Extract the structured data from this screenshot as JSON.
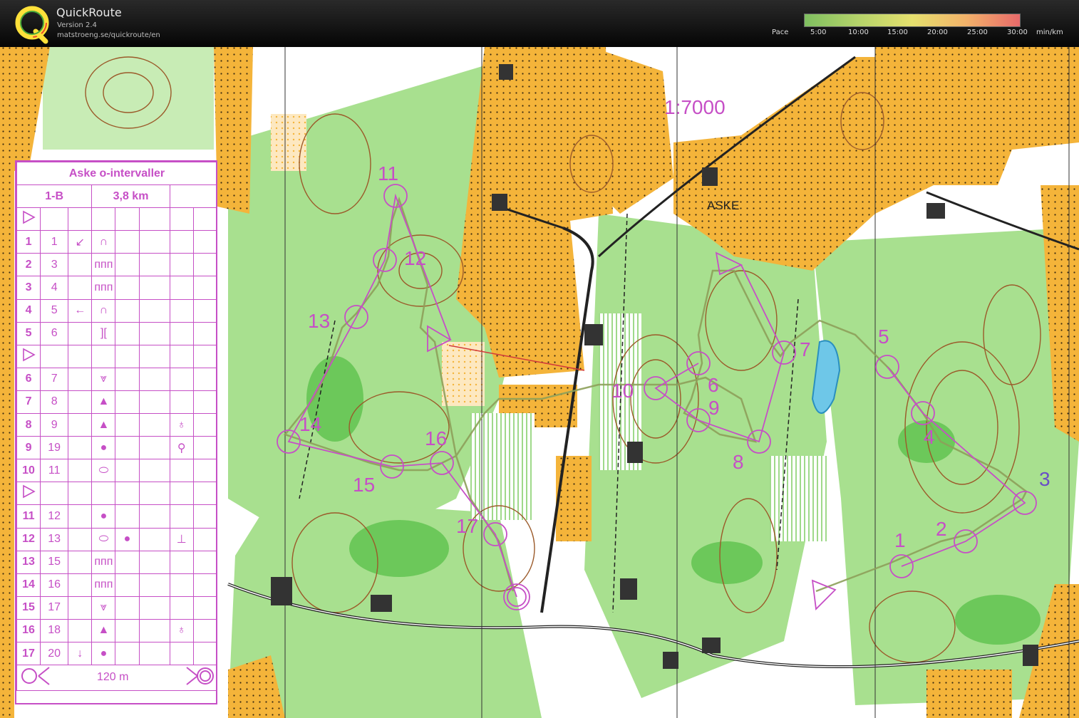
{
  "app": {
    "name": "QuickRoute",
    "version": "Version 2.4",
    "url": "matstroeng.se/quickroute/en"
  },
  "pace_legend": {
    "label": "Pace",
    "ticks": [
      "5:00",
      "10:00",
      "15:00",
      "20:00",
      "25:00",
      "30:00"
    ],
    "unit": "min/km"
  },
  "map": {
    "scale": "1:7000",
    "place_name": "ASKE",
    "control_labels": [
      "1",
      "2",
      "3",
      "4",
      "5",
      "6",
      "7",
      "8",
      "9",
      "10",
      "11",
      "12",
      "13",
      "14",
      "15",
      "16",
      "17"
    ]
  },
  "description_sheet": {
    "event": "Aske o-intervaller",
    "course": "1-B",
    "length": "3,8 km",
    "rows": [
      {
        "type": "start"
      },
      {
        "n": "1",
        "code": "1",
        "dir": "↙",
        "feat": "∩"
      },
      {
        "n": "2",
        "code": "3",
        "feat": "ᴨᴨᴨ"
      },
      {
        "n": "3",
        "code": "4",
        "feat": "ᴨᴨᴨ"
      },
      {
        "n": "4",
        "code": "5",
        "dir": "←",
        "feat": "∩"
      },
      {
        "n": "5",
        "code": "6",
        "feat": "][ "
      },
      {
        "type": "start"
      },
      {
        "n": "6",
        "code": "7",
        "feat": "⩔"
      },
      {
        "n": "7",
        "code": "8",
        "feat": "▲"
      },
      {
        "n": "8",
        "code": "9",
        "feat": "▲",
        "extra": "♁"
      },
      {
        "n": "9",
        "code": "19",
        "feat": "●",
        "extra": "⚲"
      },
      {
        "n": "10",
        "code": "11",
        "feat": "⬭"
      },
      {
        "type": "start"
      },
      {
        "n": "11",
        "code": "12",
        "feat": "●"
      },
      {
        "n": "12",
        "code": "13",
        "feat": "⬭",
        "mid": "●",
        "extra": "⊥"
      },
      {
        "n": "13",
        "code": "15",
        "feat": "ᴨᴨᴨ"
      },
      {
        "n": "14",
        "code": "16",
        "feat": "ᴨᴨᴨ"
      },
      {
        "n": "15",
        "code": "17",
        "feat": "⩔"
      },
      {
        "n": "16",
        "code": "18",
        "feat": "▲",
        "extra": "♁"
      },
      {
        "n": "17",
        "code": "20",
        "dir": "↓",
        "feat": "●"
      }
    ],
    "footer": "120 m"
  },
  "colors": {
    "open_land": "#f4b43a",
    "forest": "#ffffff",
    "green": "#8fd37a",
    "contour": "#9b5a2a",
    "course": "#c64fc6",
    "topbar": "#111111"
  }
}
